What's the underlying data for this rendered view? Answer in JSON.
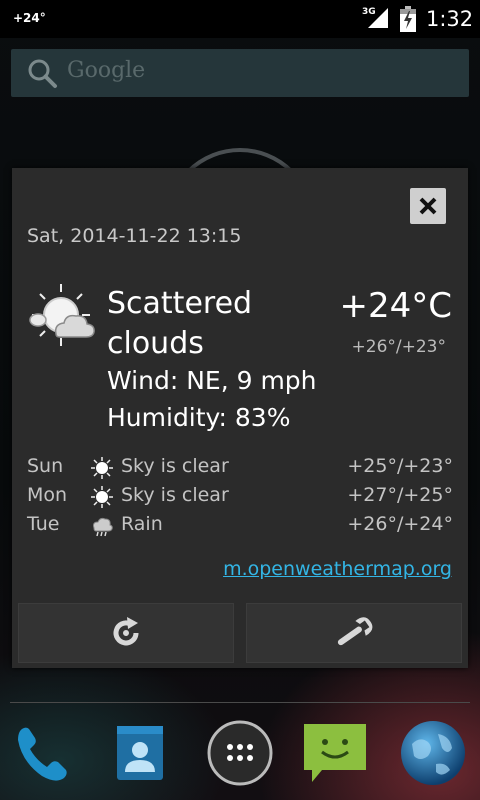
{
  "status_bar": {
    "temperature": "+24°",
    "network": "3G",
    "time": "1:32"
  },
  "search": {
    "placeholder": "Google"
  },
  "weather": {
    "datetime": "Sat, 2014-11-22 13:15",
    "condition": "Scattered clouds",
    "condition_icon": "partly-cloudy-icon",
    "wind": "Wind: NE, 9 mph",
    "humidity": "Humidity: 83%",
    "temperature": "+24°C",
    "high_low": "+26°/+23°",
    "forecast": [
      {
        "day": "Sun",
        "icon": "sun-icon",
        "description": "Sky is clear",
        "temp": "+25°/+23°"
      },
      {
        "day": "Mon",
        "icon": "sun-icon",
        "description": "Sky is clear",
        "temp": "+27°/+25°"
      },
      {
        "day": "Tue",
        "icon": "rain-icon",
        "description": "Rain",
        "temp": "+26°/+24°"
      }
    ],
    "source_link": "m.openweathermap.org"
  },
  "colors": {
    "accent": "#33b5e5",
    "dialog_bg": "#2b2b2b",
    "search_bg": "#25363a"
  },
  "dock": [
    {
      "icon": "phone-icon"
    },
    {
      "icon": "contacts-icon"
    },
    {
      "icon": "app-drawer-icon"
    },
    {
      "icon": "messaging-icon"
    },
    {
      "icon": "browser-globe-icon"
    }
  ]
}
